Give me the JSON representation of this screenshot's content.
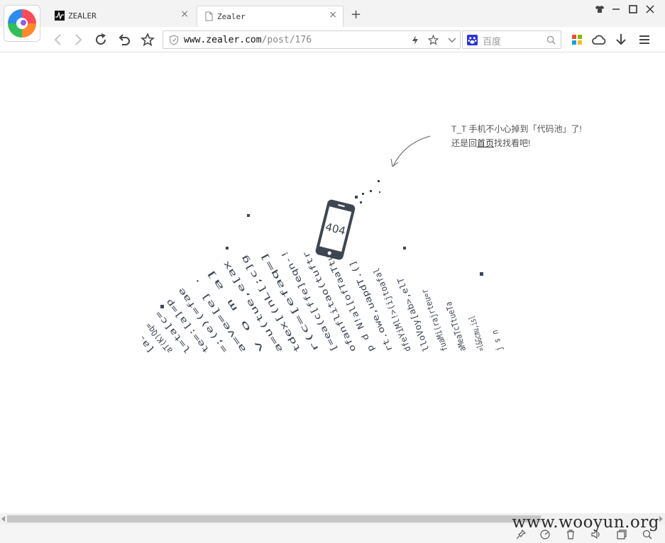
{
  "browser": {
    "tabs": [
      {
        "title": "ZEALER",
        "close": "×"
      },
      {
        "title": "Zealer",
        "close": "×"
      }
    ],
    "new_tab": "+",
    "address": {
      "domain": "www.zealer.com",
      "path": "/post/176"
    },
    "search": {
      "engine": "baidu-icon",
      "placeholder": "百度"
    }
  },
  "page": {
    "error_code": "404",
    "message_line1": "T_T 手机不小心掉到「代码池」了!",
    "message_line2_prefix": "还是回",
    "message_link": "首页",
    "message_line2_suffix": "找找看吧!",
    "code_columns": [
      "[as",
      "aT(K)Qq=",
      "l=ta[c=",
      "te=:[a]=p",
      "=;(e)(=fae",
      "a=ve=[e] .",
      "v o m a]",
      "a=u(tue,e[ax",
      "tdex[(nL[;c]g",
      "r(c=[efaq=]",
      "[=ea(c[ffe]eqn-!",
      "ofanflitao(tuftr",
      "p d N!al[ofTaaTtu",
      "rt.owe,uapdT.(]",
      "dfeYiMl!>(ijtoafal",
      "lloVoy[ab>,elT",
      "fuaMi(rajrteu=r",
      "aMeaTcTtueTa",
      "=l&Gcmu,isl",
      "j s n"
    ]
  },
  "status": {
    "watermark": "www.wooyun.org"
  },
  "colors": {
    "accent": "#3e4652",
    "tab_bg": "#f3f3f3",
    "text": "#555555"
  }
}
